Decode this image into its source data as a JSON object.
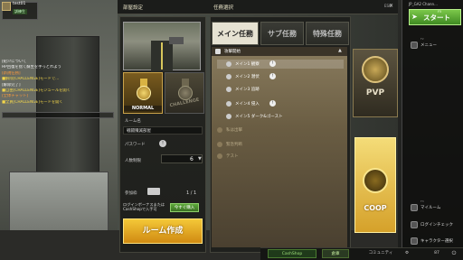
{
  "header": {
    "room_settings": "部屋設定",
    "mission_select": "任務選択",
    "esc": "ESC",
    "close": "✕"
  },
  "player": {
    "name": "test01",
    "rank": "訓練生"
  },
  "chat": [
    {
      "text": "[紹介について",
      "color": "c-white"
    },
    {
      "text": "HP回復を捨て蘇生を手っとれよう",
      "color": "c-white"
    },
    {
      "text": "[新規任務]",
      "color": "c-orange"
    },
    {
      "text": "■解除[CHALLENGE]モードで…",
      "color": "c-yellow"
    },
    {
      "text": "[解除完了]",
      "color": "c-white"
    },
    {
      "text": "■自由[CHALLENGE]モジュールを開く",
      "color": "c-yellow"
    },
    {
      "text": "[全体チャット]",
      "color": "c-orange"
    },
    {
      "text": "■全員[CHALLENGE]モードを開く",
      "color": "c-yellow"
    }
  ],
  "room": {
    "modes": {
      "normal": "NORMAL",
      "challenge": "CHALLENGE"
    },
    "room_name_label": "ルーム名",
    "room_name_value": "戦闘殲滅部屋",
    "password_label": "パスワード",
    "password_toggle": "!",
    "people_label": "人数制限",
    "people_value": "6",
    "join_label": "参加枠",
    "join_count": "1 / 1",
    "bonus_text": "ログインボーナスまたはCashShopで入手可",
    "bonus_button": "今すぐ購入",
    "create_button": "ルーム作成"
  },
  "missions": {
    "tabs": [
      "メイン任務",
      "サブ任務",
      "特殊任務"
    ],
    "group_header": "攻撃開始",
    "rows": [
      {
        "label": "メイン1 観察",
        "badge": "!"
      },
      {
        "label": "メイン2 潜伏",
        "badge": "!"
      },
      {
        "label": "メイン3 追跡",
        "badge": ""
      },
      {
        "label": "メイン4 侵入",
        "badge": "!"
      },
      {
        "label": "メイン5 ダーク&ゴースト",
        "badge": ""
      }
    ],
    "locked_rows": [
      "私は出撃",
      "緊急判断",
      "テスト"
    ]
  },
  "modes_side": {
    "pvp": "PVP",
    "coop": "COOP"
  },
  "side_menu": {
    "rank_line": "JP_GA2 Chann...",
    "start_key": "F5",
    "start": "スタート",
    "menu": "メニュー",
    "menu_key": "F2",
    "my_room": "マイルーム",
    "my_room_key": "F3",
    "login_check": "ログインチェック",
    "char_select": "キャラクター選択"
  },
  "bottom_bar": {
    "cash_shop": "CashShop",
    "warehouse": "倉庫",
    "community": "コミュニティ",
    "settings": "⚙",
    "points": "87",
    "power": "⏻"
  }
}
